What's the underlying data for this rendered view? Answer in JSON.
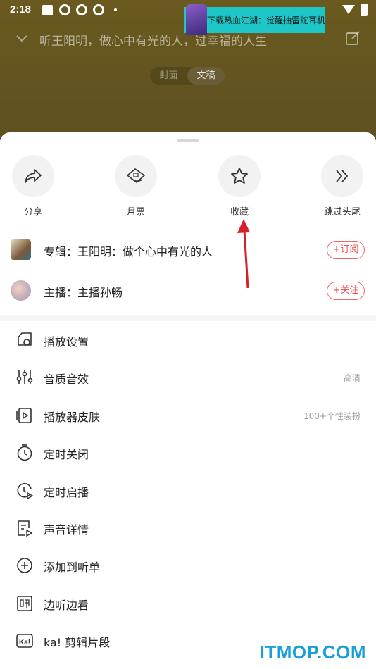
{
  "status_bar": {
    "time": "2:18"
  },
  "ad": {
    "text": "下载热血江湖：觉醒抽雷蛇耳机"
  },
  "header": {
    "title": "听王阳明，做心中有光的人，过幸福的人生"
  },
  "segment": {
    "items": [
      "封面",
      "文稿"
    ],
    "active": "文稿"
  },
  "actions": [
    {
      "label": "分享",
      "icon": "share-icon"
    },
    {
      "label": "月票",
      "icon": "ticket-icon"
    },
    {
      "label": "收藏",
      "icon": "star-icon"
    },
    {
      "label": "跳过头尾",
      "icon": "double-chevron-right-icon"
    }
  ],
  "album": {
    "text": "专辑：王阳明：做个心中有光的人",
    "button": "+订阅"
  },
  "anchor": {
    "text": "主播：主播孙畅",
    "button": "+关注"
  },
  "menu": [
    {
      "label": "播放设置",
      "icon": "play-settings-icon",
      "right": ""
    },
    {
      "label": "音质音效",
      "icon": "equalizer-icon",
      "right": "高清"
    },
    {
      "label": "播放器皮肤",
      "icon": "player-skin-icon",
      "right": "100+个性装扮"
    },
    {
      "label": "定时关闭",
      "icon": "timer-icon",
      "right": ""
    },
    {
      "label": "定时启播",
      "icon": "timer-play-icon",
      "right": ""
    },
    {
      "label": "声音详情",
      "icon": "document-icon",
      "right": ""
    },
    {
      "label": "添加到听单",
      "icon": "add-circle-icon",
      "right": ""
    },
    {
      "label": "边听边看",
      "icon": "listen-read-icon",
      "right": ""
    },
    {
      "label": "ka! 剪辑片段",
      "icon": "ka-clip-icon",
      "right": ""
    }
  ],
  "watermark": "ITMOP.COM",
  "colors": {
    "accent_red": "#f04e4e",
    "watermark_blue": "#1b9fd8",
    "bg_overlay": "#5e5020"
  }
}
